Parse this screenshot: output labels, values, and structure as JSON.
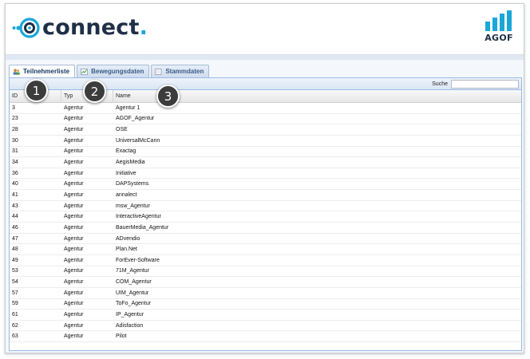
{
  "header": {
    "logo_text": "connect",
    "logo_dot": ".",
    "brand_logo_text": "AGOF"
  },
  "tabs": [
    {
      "label": "Teilnehmerliste",
      "icon": "users-icon",
      "active": true
    },
    {
      "label": "Bewegungsdaten",
      "icon": "chart-icon",
      "active": false
    },
    {
      "label": "Stammdaten",
      "icon": "document-icon",
      "active": false
    }
  ],
  "search": {
    "label": "Suche",
    "value": ""
  },
  "table": {
    "columns": [
      "ID",
      "Typ",
      "Name"
    ],
    "rows": [
      [
        "3",
        "Agentur",
        "Agentur 1"
      ],
      [
        "23",
        "Agentur",
        "AGOF_Agentur"
      ],
      [
        "28",
        "Agentur",
        "OSE"
      ],
      [
        "30",
        "Agentur",
        "UniversalMcCann"
      ],
      [
        "31",
        "Agentur",
        "Exactag"
      ],
      [
        "34",
        "Agentur",
        "AegisMedia"
      ],
      [
        "36",
        "Agentur",
        "Initiative"
      ],
      [
        "40",
        "Agentur",
        "DAPSystems"
      ],
      [
        "41",
        "Agentur",
        "annalect"
      ],
      [
        "43",
        "Agentur",
        "msw_Agentur"
      ],
      [
        "44",
        "Agentur",
        "InteractiveAgentur"
      ],
      [
        "46",
        "Agentur",
        "BauerMedia_Agentur"
      ],
      [
        "47",
        "Agentur",
        "ADvendio"
      ],
      [
        "48",
        "Agentur",
        "Plan.Net"
      ],
      [
        "49",
        "Agentur",
        "ForEver-Software"
      ],
      [
        "53",
        "Agentur",
        "71M_Agentur"
      ],
      [
        "54",
        "Agentur",
        "COM_Agentur"
      ],
      [
        "57",
        "Agentur",
        "UIM_Agentur"
      ],
      [
        "59",
        "Agentur",
        "ToFo_Agentur"
      ],
      [
        "61",
        "Agentur",
        "IP_Agentur"
      ],
      [
        "62",
        "Agentur",
        "Adisfaction"
      ],
      [
        "63",
        "Agentur",
        "Pilot"
      ]
    ]
  },
  "callouts": [
    "1",
    "2",
    "3"
  ],
  "colors": {
    "brand_dark": "#1f2f46",
    "brand_accent": "#1aa7d8",
    "tab_border": "#a7bcd6",
    "grid_border": "#99bbe8",
    "callout_bg": "#3c3c3c"
  }
}
